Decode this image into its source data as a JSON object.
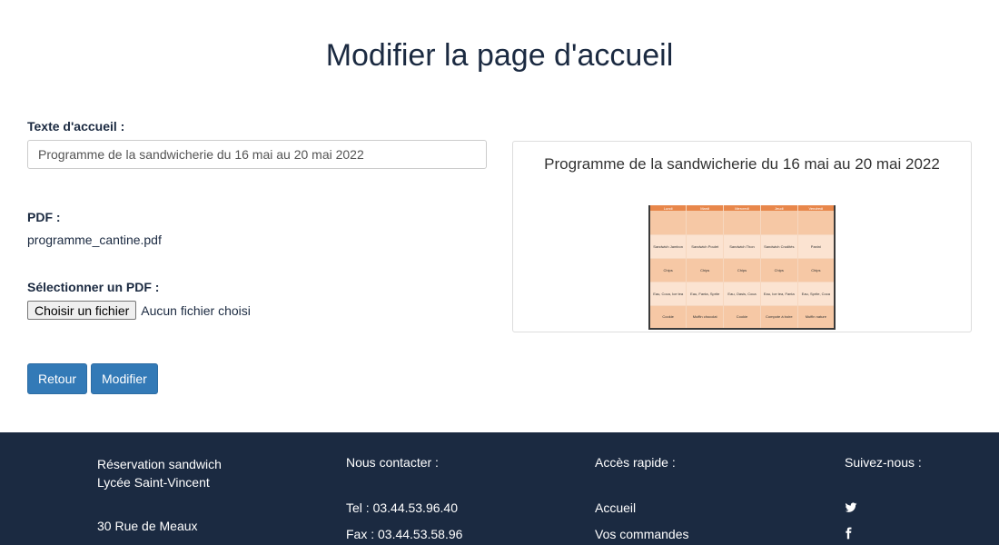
{
  "page": {
    "title": "Modifier la page d'accueil"
  },
  "form": {
    "welcome_label": "Texte d'accueil :",
    "welcome_value": "Programme de la sandwicherie du 16 mai au 20 mai 2022",
    "pdf_label": "PDF :",
    "pdf_filename": "programme_cantine.pdf",
    "select_pdf_label": "Sélectionner un PDF :",
    "file_button": "Choisir un fichier",
    "file_status": "Aucun fichier choisi",
    "back_button": "Retour",
    "submit_button": "Modifier"
  },
  "preview": {
    "title": "Programme de la sandwicherie du 16 mai au 20 mai 2022",
    "table": {
      "headers": [
        "Lundi",
        "Mardi",
        "Mercredi",
        "Jeudi",
        "Vendredi"
      ],
      "rows": [
        [
          "",
          "",
          "",
          "",
          ""
        ],
        [
          "Sandwich Jambon",
          "Sandwich Poulet",
          "Sandwich Thon",
          "Sandwich Crudités",
          "Panini"
        ],
        [
          "Chips",
          "Chips",
          "Chips",
          "Chips",
          "Chips"
        ],
        [
          "Eau, Coca, Ice tea",
          "Eau, Fanta, Sprite",
          "Eau, Oasis, Coca",
          "Eau, Ice tea, Fanta",
          "Eau, Sprite, Coca"
        ],
        [
          "Cookie",
          "Muffin chocolat",
          "Cookie",
          "Compote à boire",
          "Muffin nature"
        ]
      ]
    }
  },
  "footer": {
    "brand_line1": "Réservation sandwich",
    "brand_line2": "Lycée Saint-Vincent",
    "address": "30 Rue de Meaux",
    "contact_title": "Nous contacter :",
    "tel": "Tel : 03.44.53.96.40",
    "fax": "Fax : 03.44.53.58.96",
    "quick_title": "Accès rapide :",
    "quick_links": [
      "Accueil",
      "Vos commandes"
    ],
    "follow_title": "Suivez-nous :",
    "social_icons": [
      "twitter-icon",
      "facebook-icon"
    ]
  },
  "colors": {
    "footer_bg": "#1b2a41",
    "primary_button": "#337ab7",
    "table_header": "#e8874b"
  }
}
